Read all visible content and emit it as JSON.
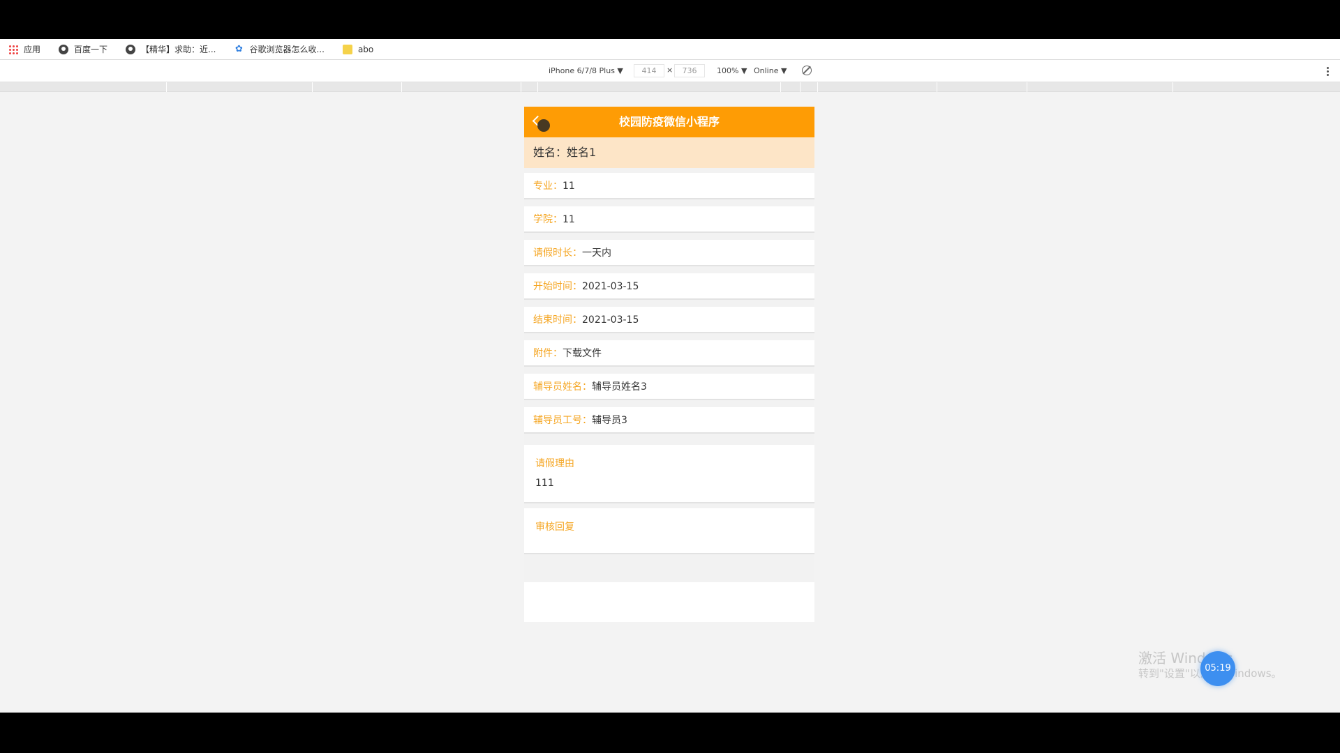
{
  "bookmarks": [
    {
      "label": "应用",
      "icon": "apps-icon"
    },
    {
      "label": "百度一下",
      "icon": "globe-icon"
    },
    {
      "label": "【精华】求助：近...",
      "icon": "globe-icon"
    },
    {
      "label": "谷歌浏览器怎么收...",
      "icon": "paw-icon"
    },
    {
      "label": "abo",
      "icon": "folder-icon"
    }
  ],
  "devtools": {
    "device": "iPhone 6/7/8 Plus ▼",
    "width": "414",
    "times": "×",
    "height": "736",
    "zoom": "100% ▼",
    "network": "Online ▼"
  },
  "app": {
    "title": "校园防疫微信小程序",
    "accent_color": "#fe9c05",
    "name_label": "姓名：",
    "name_value": "姓名1"
  },
  "fields": [
    {
      "label": "专业：",
      "value": "11"
    },
    {
      "label": "学院：",
      "value": "11"
    },
    {
      "label": "请假时长：",
      "value": "一天内"
    },
    {
      "label": "开始时间：",
      "value": "2021-03-15"
    },
    {
      "label": "结束时间：",
      "value": "2021-03-15"
    },
    {
      "label": "附件：",
      "value": "下载文件"
    },
    {
      "label": "辅导员姓名：",
      "value": "辅导员姓名3"
    },
    {
      "label": "辅导员工号：",
      "value": "辅导员3"
    }
  ],
  "reason": {
    "title": "请假理由",
    "value": "111"
  },
  "review": {
    "title": "审核回复",
    "value": ""
  },
  "overlay": {
    "watermark_line1": "激活 Windows",
    "watermark_line2": "转到\"设置\"以激活 Windows。",
    "timer": "05:19"
  }
}
